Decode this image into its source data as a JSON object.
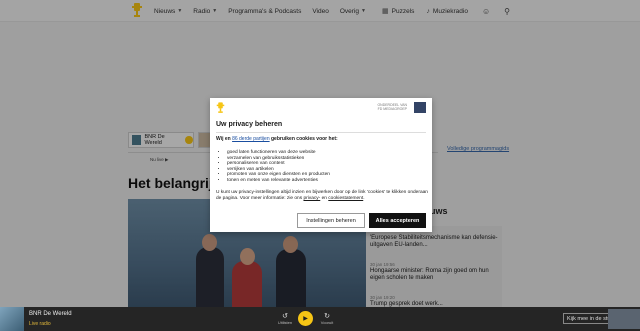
{
  "colors": {
    "brand_yellow": "#f6c515",
    "accept_button": "#111111",
    "link_blue": "#1a4ea0"
  },
  "topbar": {
    "logo": "bnr-logo-icon",
    "nav": [
      {
        "label": "Nieuws",
        "has_dropdown": true
      },
      {
        "label": "Radio",
        "has_dropdown": true
      },
      {
        "label": "Programma's & Podcasts",
        "has_dropdown": false
      },
      {
        "label": "Video",
        "has_dropdown": false
      },
      {
        "label": "Overig",
        "has_dropdown": true
      }
    ],
    "puzzels": "Puzzels",
    "muziekradio": "Muziekradio"
  },
  "page": {
    "program_card_label": "BNR De Wereld",
    "nu_live": "Nu live",
    "headline": "Het belangrijk",
    "volledige": "Volledige programmagids",
    "news_heading": "Nieuws",
    "news": [
      {
        "time": "",
        "text": "'Europese Stabiliteitsmechanisme kan defensie-uitgaven EU-landen..."
      },
      {
        "time": "30 jan 19:56",
        "text": "Hongaarse minister: Roma zijn goed om hun eigen scholen te maken"
      },
      {
        "time": "30 jan 19:20",
        "text": "Trump gesprek doet werk..."
      }
    ]
  },
  "modal": {
    "partner_text": "ONDERDEEL VAN FD MEDIAGROEP",
    "title": "Uw privacy beheren",
    "intro_prefix": "Wij en ",
    "intro_link": "86 derde partijen",
    "intro_suffix": " gebruiken cookies voor het:",
    "purposes": [
      "goed laten functioneren van deze website",
      "verzamelen van gebruiksstatistieken",
      "personaliseren van content",
      "verrijken van artikelen",
      "promoten van onze eigen diensten en producten",
      "tonen en meten van relevante advertenties"
    ],
    "footnote_main": "U kunt uw privacy-instellingen altijd inzien en bijwerken door op de link 'cookies' te klikken onderaan de pagina. Voor meer informatie: zie ons ",
    "privacy_link": "privacy-",
    "footnote_and": " en ",
    "cookie_link": "cookiestatement",
    "footnote_end": ".",
    "settings_button": "Instellingen beheren",
    "accept_button": "Alles accepteren"
  },
  "player": {
    "station": "BNR De Wereld",
    "live": "Live radio",
    "rewind_label": "Uitlisten",
    "forward_label": "Vooruit",
    "studio_button": "Kijk mee in de studio"
  }
}
